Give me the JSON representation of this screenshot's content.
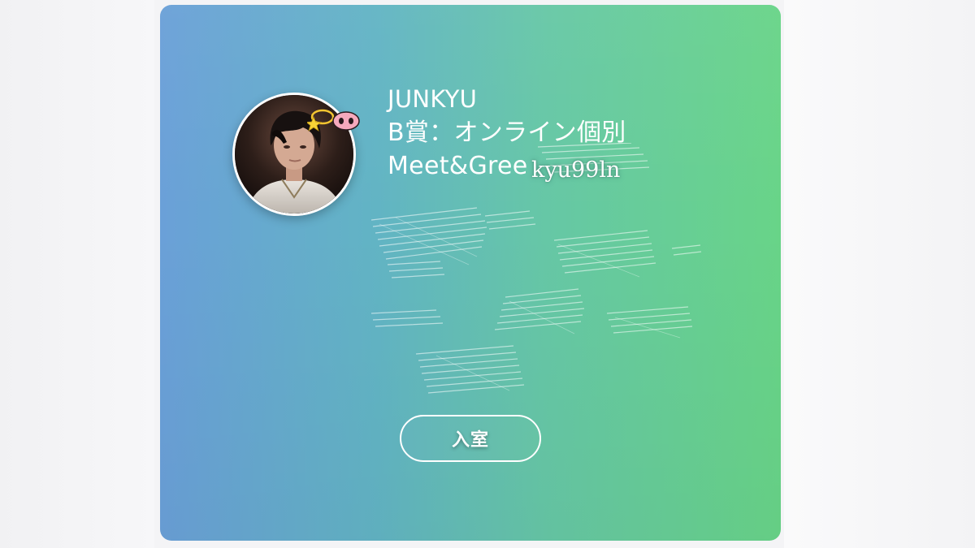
{
  "card": {
    "gradient_start": "#6aa0d8",
    "gradient_end": "#68d488",
    "avatar_alt": "avatar-photo",
    "stickers": [
      "halo-star-icon",
      "pig-nose-icon"
    ],
    "info": {
      "name": "JUNKYU",
      "prize_line": "B賞：オンライン個別",
      "event_line": "Meet&Gree"
    },
    "handle_overlay": "kyu99ln",
    "enter_button_label": "入室"
  }
}
